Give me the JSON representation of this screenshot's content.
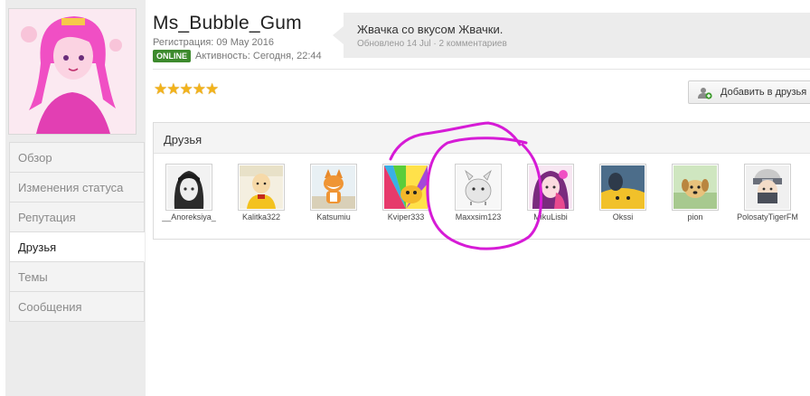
{
  "profile": {
    "username": "Ms_Bubble_Gum",
    "registration": "Регистрация: 09 May 2016",
    "online_badge": "ONLINE",
    "activity": "Активность: Сегодня, 22:44",
    "rating_stars": 5
  },
  "status": {
    "text": "Жвачка со вкусом Жвачки.",
    "meta": "Обновлено 14 Jul · 2 комментариев"
  },
  "actions": {
    "add_friend": "Добавить в друзья"
  },
  "nav": {
    "items": [
      {
        "label": "Обзор"
      },
      {
        "label": "Изменения статуса"
      },
      {
        "label": "Репутация"
      },
      {
        "label": "Друзья",
        "active": true
      },
      {
        "label": "Темы"
      },
      {
        "label": "Сообщения"
      }
    ]
  },
  "friends": {
    "title": "Друзья",
    "list": [
      {
        "name": "__Anoreksiya_",
        "icon": "manga-girl-avatar"
      },
      {
        "name": "Kalitka322",
        "icon": "bald-hero-avatar"
      },
      {
        "name": "Katsumiu",
        "icon": "fox-avatar"
      },
      {
        "name": "Kviper333",
        "icon": "rainbow-dog-avatar"
      },
      {
        "name": "Maxxsim123",
        "icon": "white-creature-avatar"
      },
      {
        "name": "MikuLisbi",
        "icon": "anime-girl-avatar"
      },
      {
        "name": "Okssi",
        "icon": "yellow-dog-avatar"
      },
      {
        "name": "pion",
        "icon": "puppy-avatar"
      },
      {
        "name": "PolosatyTigerFM",
        "icon": "masked-ninja-avatar"
      }
    ]
  },
  "colors": {
    "online_green": "#3d8a2d",
    "star_gold": "#f2b31b",
    "annotation_magenta": "#d61bd6"
  }
}
